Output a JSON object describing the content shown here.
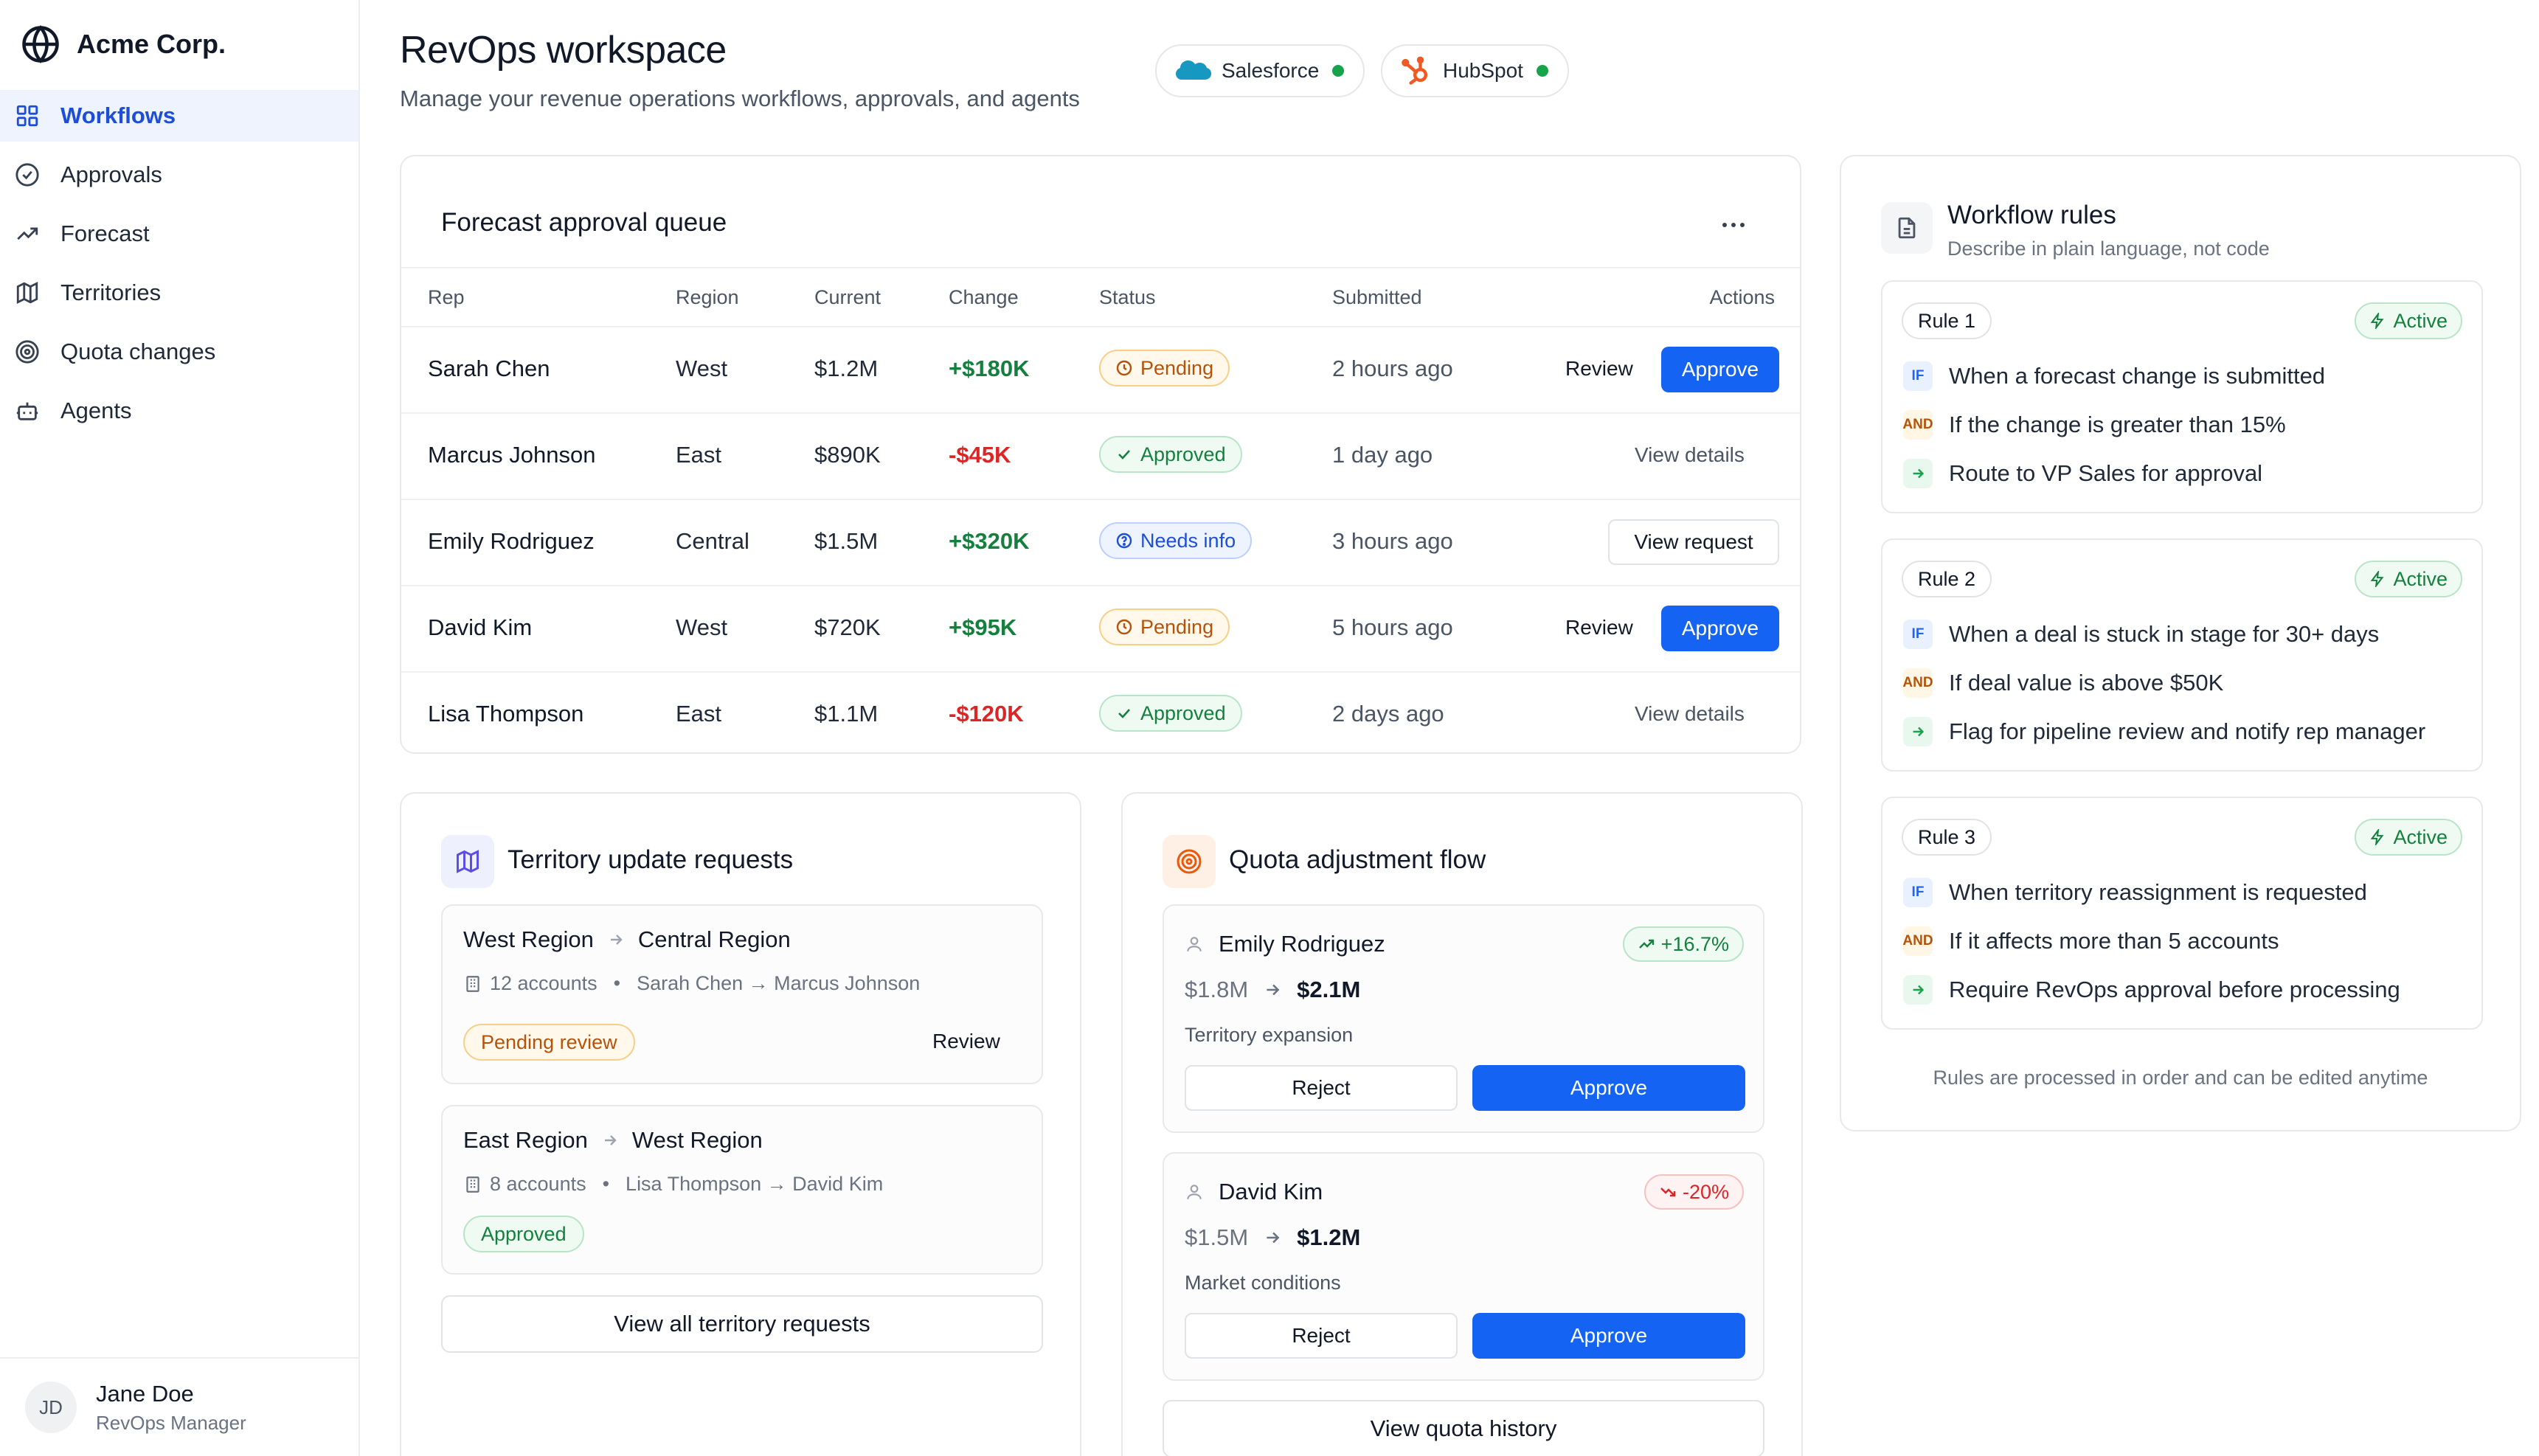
{
  "brand": {
    "name": "Acme Corp."
  },
  "nav": {
    "items": [
      {
        "label": "Workflows",
        "icon": "grid-icon",
        "active": true
      },
      {
        "label": "Approvals",
        "icon": "check-circle-icon",
        "active": false
      },
      {
        "label": "Forecast",
        "icon": "trending-up-icon",
        "active": false
      },
      {
        "label": "Territories",
        "icon": "map-icon",
        "active": false
      },
      {
        "label": "Quota changes",
        "icon": "target-icon",
        "active": false
      },
      {
        "label": "Agents",
        "icon": "bot-icon",
        "active": false
      }
    ]
  },
  "user": {
    "initials": "JD",
    "name": "Jane Doe",
    "role": "RevOps Manager"
  },
  "header": {
    "title": "RevOps workspace",
    "subtitle": "Manage your revenue operations workflows, approvals, and agents",
    "integrations": [
      {
        "name": "Salesforce",
        "icon": "salesforce-icon",
        "status_color": "#16a34a"
      },
      {
        "name": "HubSpot",
        "icon": "hubspot-icon",
        "status_color": "#16a34a"
      }
    ]
  },
  "queue": {
    "title": "Forecast approval queue",
    "more_icon": "ellipsis-icon",
    "columns": [
      "Rep",
      "Region",
      "Current",
      "Change",
      "Status",
      "Submitted",
      "Actions"
    ],
    "rows": [
      {
        "rep": "Sarah Chen",
        "region": "West",
        "current": "$1.2M",
        "change": "+$180K",
        "status": "Pending",
        "submitted": "2 hours ago",
        "secondary": "Review",
        "primary": "Approve"
      },
      {
        "rep": "Marcus Johnson",
        "region": "East",
        "current": "$890K",
        "change": "-$45K",
        "status": "Approved",
        "submitted": "1 day ago",
        "link": "View details"
      },
      {
        "rep": "Emily Rodriguez",
        "region": "Central",
        "current": "$1.5M",
        "change": "+$320K",
        "status": "Needs info",
        "submitted": "3 hours ago",
        "outline": "View request"
      },
      {
        "rep": "David Kim",
        "region": "West",
        "current": "$720K",
        "change": "+$95K",
        "status": "Pending",
        "submitted": "5 hours ago",
        "secondary": "Review",
        "primary": "Approve"
      },
      {
        "rep": "Lisa Thompson",
        "region": "East",
        "current": "$1.1M",
        "change": "-$120K",
        "status": "Approved",
        "submitted": "2 days ago",
        "link": "View details"
      }
    ]
  },
  "territory": {
    "title": "Territory update requests",
    "requests": [
      {
        "from": "West Region",
        "to": "Central Region",
        "accounts": "12 accounts",
        "reps": "Sarah Chen → Marcus Johnson",
        "status": "Pending review",
        "action": "Review"
      },
      {
        "from": "East Region",
        "to": "West Region",
        "accounts": "8 accounts",
        "reps": "Lisa Thompson → David Kim",
        "status": "Approved"
      }
    ],
    "view_all": "View all territory requests"
  },
  "quota": {
    "title": "Quota adjustment flow",
    "items": [
      {
        "name": "Emily Rodriguez",
        "delta": "+16.7%",
        "direction": "up",
        "from": "$1.8M",
        "to": "$2.1M",
        "reason": "Territory expansion",
        "reject": "Reject",
        "approve": "Approve"
      },
      {
        "name": "David Kim",
        "delta": "-20%",
        "direction": "down",
        "from": "$1.5M",
        "to": "$1.2M",
        "reason": "Market conditions",
        "reject": "Reject",
        "approve": "Approve"
      }
    ],
    "view_history": "View quota history"
  },
  "rules": {
    "title": "Workflow rules",
    "subtitle": "Describe in plain language, not code",
    "items": [
      {
        "tag": "Rule 1",
        "status": "Active",
        "if": "When a forecast change is submitted",
        "and": "If the change is greater than 15%",
        "then": "Route to VP Sales for approval"
      },
      {
        "tag": "Rule 2",
        "status": "Active",
        "if": "When a deal is stuck in stage for 30+ days",
        "and": "If deal value is above $50K",
        "then": "Flag for pipeline review and notify rep manager"
      },
      {
        "tag": "Rule 3",
        "status": "Active",
        "if": "When territory reassignment is requested",
        "and": "If it affects more than 5 accounts",
        "then": "Require RevOps approval before processing"
      }
    ],
    "kw_if": "IF",
    "kw_and": "AND",
    "footer": "Rules are processed in order and can be edited anytime"
  },
  "colors": {
    "accent": "#1463f3",
    "positive": "#15803d",
    "negative": "#dc2626",
    "pending": "#b45309"
  }
}
